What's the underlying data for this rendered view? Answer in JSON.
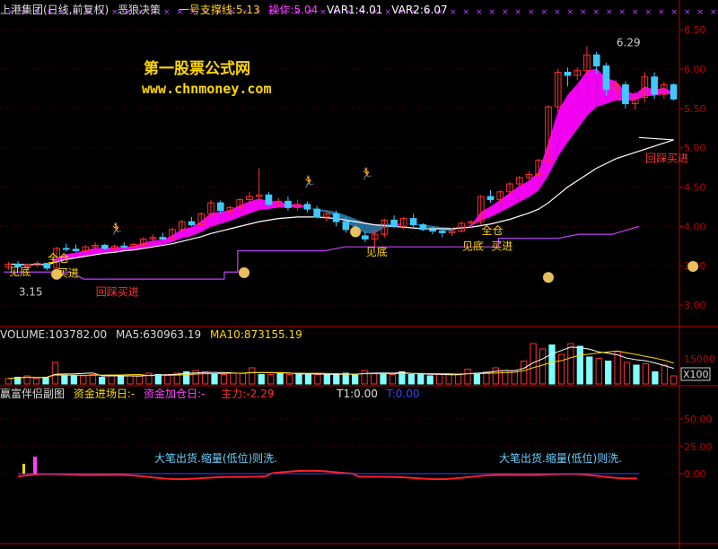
{
  "header": {
    "title": "上港集团(日线,前复权)",
    "indicator_name": "恶狼决策",
    "support_label": "一号支撑线:5.13",
    "op_label": "操作:5.04",
    "var1_label": "VAR1:4.01",
    "var2_label": "VAR2:6.07"
  },
  "watermark": {
    "line1": "第一股票公式网",
    "line2": "www.chnmoney.com"
  },
  "colors": {
    "up": "#ff3030",
    "down": "#40c8ff",
    "ribbon_up": "#ff00ff",
    "ribbon_down": "#2a7fb0",
    "support": "#c040ff",
    "ma": "#ffffff",
    "label_yellow": "#ffd700",
    "label_red": "#ff3030",
    "axis": "#c00000"
  },
  "volume_header": {
    "volume": "VOLUME:103782.00",
    "ma5": "MA5:630963.19",
    "ma10": "MA10:873155.19"
  },
  "sub_header": {
    "name": "赢富伴侣副图",
    "inflow": "资金进场日:-",
    "add": "资金加仓日:-",
    "main": "主力:-2.29",
    "t1": "T1:0.00",
    "t2": "T:0.00"
  },
  "sub_annotations": [
    "大笔出货.缩量(低位)则洗.",
    "大笔出货.缩量(低位)则洗."
  ],
  "chart_data": [
    {
      "type": "candlestick",
      "ylim": [
        2.75,
        6.65
      ],
      "yticks": [
        "6.50",
        "6.00",
        "5.50",
        "5.00",
        "4.50",
        "4.00",
        "3.50",
        "3.00"
      ],
      "ohlc": [
        [
          3.48,
          3.55,
          3.45,
          3.52
        ],
        [
          3.52,
          3.56,
          3.47,
          3.49
        ],
        [
          3.49,
          3.53,
          3.44,
          3.51
        ],
        [
          3.51,
          3.56,
          3.48,
          3.53
        ],
        [
          3.53,
          3.54,
          3.44,
          3.47
        ],
        [
          3.47,
          3.74,
          3.46,
          3.72
        ],
        [
          3.72,
          3.78,
          3.68,
          3.71
        ],
        [
          3.71,
          3.77,
          3.67,
          3.69
        ],
        [
          3.69,
          3.76,
          3.66,
          3.74
        ],
        [
          3.74,
          3.8,
          3.71,
          3.76
        ],
        [
          3.76,
          3.78,
          3.7,
          3.72
        ],
        [
          3.72,
          3.77,
          3.69,
          3.75
        ],
        [
          3.75,
          3.8,
          3.72,
          3.74
        ],
        [
          3.74,
          3.79,
          3.71,
          3.77
        ],
        [
          3.77,
          3.86,
          3.74,
          3.84
        ],
        [
          3.84,
          3.9,
          3.8,
          3.86
        ],
        [
          3.86,
          3.92,
          3.82,
          3.84
        ],
        [
          3.84,
          3.98,
          3.82,
          3.96
        ],
        [
          3.96,
          4.08,
          3.92,
          4.06
        ],
        [
          4.06,
          4.12,
          4.0,
          4.02
        ],
        [
          4.02,
          4.18,
          4.0,
          4.16
        ],
        [
          4.16,
          4.34,
          4.12,
          4.3
        ],
        [
          4.3,
          4.33,
          4.16,
          4.2
        ],
        [
          4.2,
          4.26,
          4.14,
          4.24
        ],
        [
          4.24,
          4.36,
          4.2,
          4.34
        ],
        [
          4.34,
          4.44,
          4.3,
          4.38
        ],
        [
          4.38,
          4.74,
          4.34,
          4.4
        ],
        [
          4.4,
          4.44,
          4.26,
          4.28
        ],
        [
          4.28,
          4.36,
          4.24,
          4.32
        ],
        [
          4.32,
          4.38,
          4.2,
          4.24
        ],
        [
          4.24,
          4.34,
          4.2,
          4.28
        ],
        [
          4.28,
          4.32,
          4.18,
          4.22
        ],
        [
          4.22,
          4.26,
          4.1,
          4.12
        ],
        [
          4.12,
          4.2,
          4.06,
          4.16
        ],
        [
          4.16,
          4.2,
          4.0,
          4.06
        ],
        [
          4.06,
          4.12,
          3.92,
          3.96
        ],
        [
          3.96,
          4.02,
          3.86,
          3.88
        ],
        [
          3.88,
          3.94,
          3.8,
          3.84
        ],
        [
          3.84,
          3.96,
          3.74,
          3.9
        ],
        [
          3.9,
          4.1,
          3.86,
          4.08
        ],
        [
          4.08,
          4.14,
          3.98,
          4.0
        ],
        [
          4.0,
          4.12,
          3.96,
          4.1
        ],
        [
          4.1,
          4.16,
          3.98,
          4.02
        ],
        [
          4.02,
          4.04,
          3.94,
          3.96
        ],
        [
          3.96,
          4.0,
          3.9,
          3.94
        ],
        [
          3.94,
          3.98,
          3.86,
          3.92
        ],
        [
          3.92,
          3.98,
          3.88,
          3.94
        ],
        [
          3.94,
          4.06,
          3.92,
          4.04
        ],
        [
          4.04,
          4.08,
          3.98,
          4.06
        ],
        [
          4.06,
          4.4,
          4.02,
          4.38
        ],
        [
          4.38,
          4.46,
          4.3,
          4.34
        ],
        [
          4.34,
          4.46,
          4.3,
          4.44
        ],
        [
          4.44,
          4.56,
          4.4,
          4.54
        ],
        [
          4.54,
          4.64,
          4.5,
          4.62
        ],
        [
          4.62,
          4.7,
          4.58,
          4.66
        ],
        [
          4.66,
          4.86,
          4.62,
          4.84
        ],
        [
          4.84,
          5.54,
          4.8,
          5.52
        ],
        [
          5.52,
          6.0,
          5.46,
          5.96
        ],
        [
          5.96,
          6.02,
          5.78,
          5.92
        ],
        [
          5.92,
          6.02,
          5.86,
          5.98
        ],
        [
          5.98,
          6.29,
          5.92,
          6.18
        ],
        [
          6.18,
          6.22,
          5.94,
          6.04
        ],
        [
          6.04,
          6.08,
          5.66,
          5.74
        ],
        [
          5.74,
          5.86,
          5.6,
          5.8
        ],
        [
          5.8,
          5.84,
          5.5,
          5.56
        ],
        [
          5.56,
          5.72,
          5.48,
          5.64
        ],
        [
          5.64,
          5.96,
          5.58,
          5.9
        ],
        [
          5.9,
          5.96,
          5.62,
          5.68
        ],
        [
          5.68,
          5.84,
          5.62,
          5.8
        ],
        [
          5.8,
          5.82,
          5.6,
          5.62
        ]
      ],
      "ma": [
        3.52,
        3.52,
        3.51,
        3.52,
        3.51,
        3.55,
        3.58,
        3.6,
        3.62,
        3.64,
        3.66,
        3.67,
        3.69,
        3.7,
        3.72,
        3.74,
        3.76,
        3.78,
        3.81,
        3.84,
        3.87,
        3.91,
        3.94,
        3.97,
        4.0,
        4.03,
        4.06,
        4.08,
        4.1,
        4.11,
        4.12,
        4.12,
        4.12,
        4.11,
        4.1,
        4.08,
        4.06,
        4.04,
        4.02,
        4.01,
        4.0,
        3.99,
        3.98,
        3.97,
        3.97,
        3.97,
        3.97,
        3.98,
        3.99,
        4.01,
        4.03,
        4.06,
        4.09,
        4.13,
        4.17,
        4.22,
        4.3,
        4.4,
        4.5,
        4.58,
        4.66,
        4.74,
        4.8,
        4.86,
        4.9,
        4.94,
        4.98,
        5.02,
        5.06,
        5.1
      ],
      "support_line": [
        [
          0,
          3.42
        ],
        [
          10,
          3.42
        ],
        [
          12,
          3.33
        ],
        [
          33,
          3.33
        ],
        [
          33,
          3.42
        ],
        [
          35,
          3.42
        ],
        [
          35,
          3.69
        ],
        [
          48,
          3.69
        ],
        [
          51,
          3.74
        ],
        [
          74,
          3.74
        ],
        [
          74,
          3.85
        ],
        [
          83,
          3.85
        ],
        [
          86,
          3.9
        ],
        [
          91,
          3.9
        ],
        [
          95,
          4.0
        ]
      ],
      "annotations": [
        {
          "text": "见底",
          "i": 1,
          "price": 3.38,
          "color": "#ffd700"
        },
        {
          "text": "全仓",
          "i": 5,
          "price": 3.55,
          "color": "#ffd700"
        },
        {
          "text": "买进",
          "i": 6,
          "price": 3.36,
          "color": "#ffd700"
        },
        {
          "text": "回踩买进",
          "i": 10,
          "price": 3.12,
          "color": "#ff3030"
        },
        {
          "text": "见底",
          "i": 38,
          "price": 3.63,
          "color": "#ffd700"
        },
        {
          "text": "见底",
          "i": 48,
          "price": 3.7,
          "color": "#ffd700"
        },
        {
          "text": "全仓",
          "i": 50,
          "price": 3.9,
          "color": "#ffd700"
        },
        {
          "text": "买进",
          "i": 51,
          "price": 3.7,
          "color": "#ffd700"
        },
        {
          "text": "回踩买进",
          "i": 67,
          "price": 4.82,
          "color": "#ff3030"
        },
        {
          "text": "3.15",
          "i": 2,
          "price": 3.12,
          "color": "#cccccc"
        },
        {
          "text": "6.29",
          "i": 64,
          "price": 6.29,
          "color": "#cccccc"
        }
      ]
    },
    {
      "type": "bar",
      "yticks": [
        "15000",
        "X100"
      ],
      "values": [
        4,
        5,
        6,
        4,
        5,
        16,
        6,
        6,
        6,
        7,
        5,
        6,
        6,
        6,
        6,
        8,
        7,
        7,
        8,
        9,
        10,
        9,
        7,
        7,
        8,
        8,
        12,
        7,
        7,
        8,
        7,
        8,
        7,
        7,
        7,
        7,
        8,
        7,
        10,
        8,
        8,
        7,
        9,
        7,
        7,
        6,
        7,
        7,
        7,
        11,
        8,
        9,
        12,
        10,
        10,
        17,
        30,
        26,
        29,
        22,
        30,
        28,
        20,
        19,
        17,
        24,
        16,
        14,
        15,
        9,
        14,
        6
      ]
    },
    {
      "type": "line",
      "yticks": [
        "50.00",
        "25.00",
        "0.00"
      ]
    }
  ]
}
